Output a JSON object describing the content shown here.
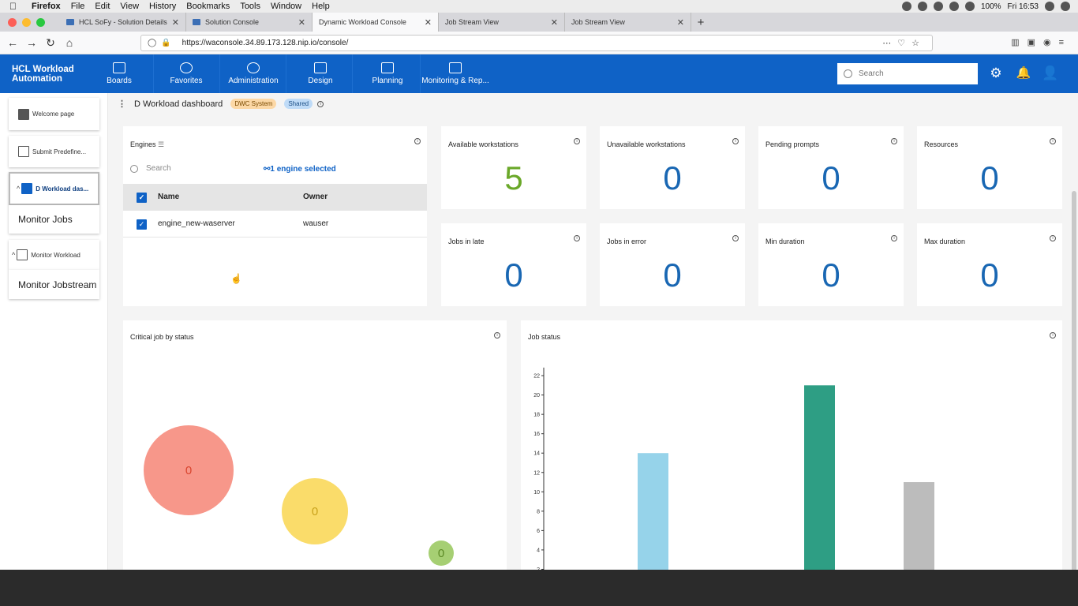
{
  "menubar": {
    "app": "Firefox",
    "items": [
      "File",
      "Edit",
      "View",
      "History",
      "Bookmarks",
      "Tools",
      "Window",
      "Help"
    ],
    "battery": "100%",
    "clock": "Fri 16:53"
  },
  "tabs": [
    {
      "label": "HCL SoFy - Solution Details",
      "active": false
    },
    {
      "label": "Solution Console",
      "active": false
    },
    {
      "label": "Dynamic Workload Console",
      "active": true
    },
    {
      "label": "Job Stream View",
      "active": false
    },
    {
      "label": "Job Stream View",
      "active": false
    }
  ],
  "browser": {
    "url": "https://waconsole.34.89.173.128.nip.io/console/"
  },
  "header": {
    "brand_line1": "HCL Workload",
    "brand_line2": "Automation",
    "nav": [
      {
        "label": "Boards",
        "icon": "boards-icon"
      },
      {
        "label": "Favorites",
        "icon": "star-icon"
      },
      {
        "label": "Administration",
        "icon": "admin-icon"
      },
      {
        "label": "Design",
        "icon": "compass-icon"
      },
      {
        "label": "Planning",
        "icon": "planning-icon"
      },
      {
        "label": "Monitoring & Rep...",
        "icon": "monitor-icon"
      }
    ],
    "search_placeholder": "Search"
  },
  "rail": {
    "welcome": "Welcome page",
    "submit": "Submit Predefine...",
    "dashboard": "D Workload das...",
    "monitor_jobs": "Monitor Jobs",
    "monitor_workload": "Monitor Workload",
    "monitor_jobstream": "Monitor Jobstream"
  },
  "dashboard": {
    "title": "D Workload dashboard",
    "pill_system": "DWC System",
    "pill_shared": "Shared"
  },
  "engines": {
    "title": "Engines",
    "search_placeholder": "Search",
    "selected_text": "1 engine selected",
    "col_name": "Name",
    "col_owner": "Owner",
    "rows": [
      {
        "name": "engine_new-waserver",
        "owner": "wauser"
      }
    ]
  },
  "metrics": [
    {
      "label": "Available workstations",
      "value": "5",
      "color": "#6aa829"
    },
    {
      "label": "Unavailable workstations",
      "value": "0",
      "color": "#1967b3"
    },
    {
      "label": "Pending prompts",
      "value": "0",
      "color": "#1967b3"
    },
    {
      "label": "Resources",
      "value": "0",
      "color": "#1967b3"
    },
    {
      "label": "Jobs in late",
      "value": "0",
      "color": "#1967b3"
    },
    {
      "label": "Jobs in error",
      "value": "0",
      "color": "#1967b3"
    },
    {
      "label": "Min duration",
      "value": "0",
      "color": "#1967b3"
    },
    {
      "label": "Max duration",
      "value": "0",
      "color": "#1967b3"
    }
  ],
  "critical": {
    "title": "Critical job by status",
    "bubbles": [
      {
        "value": "0",
        "color": "#f7978a"
      },
      {
        "value": "0",
        "color": "#fadc6a"
      },
      {
        "value": "0",
        "color": "#a6cf73"
      }
    ]
  },
  "chart_data": {
    "type": "bar",
    "title": "Job status",
    "yticks": [
      "2",
      "4",
      "6",
      "8",
      "10",
      "12",
      "14",
      "16",
      "18",
      "20",
      "22"
    ],
    "ylim": [
      0,
      22.5
    ],
    "bars": [
      {
        "value": 14,
        "color": "#96d3ea"
      },
      {
        "value": 21,
        "color": "#2e9e84"
      },
      {
        "value": 11,
        "color": "#bcbcbc"
      }
    ]
  }
}
